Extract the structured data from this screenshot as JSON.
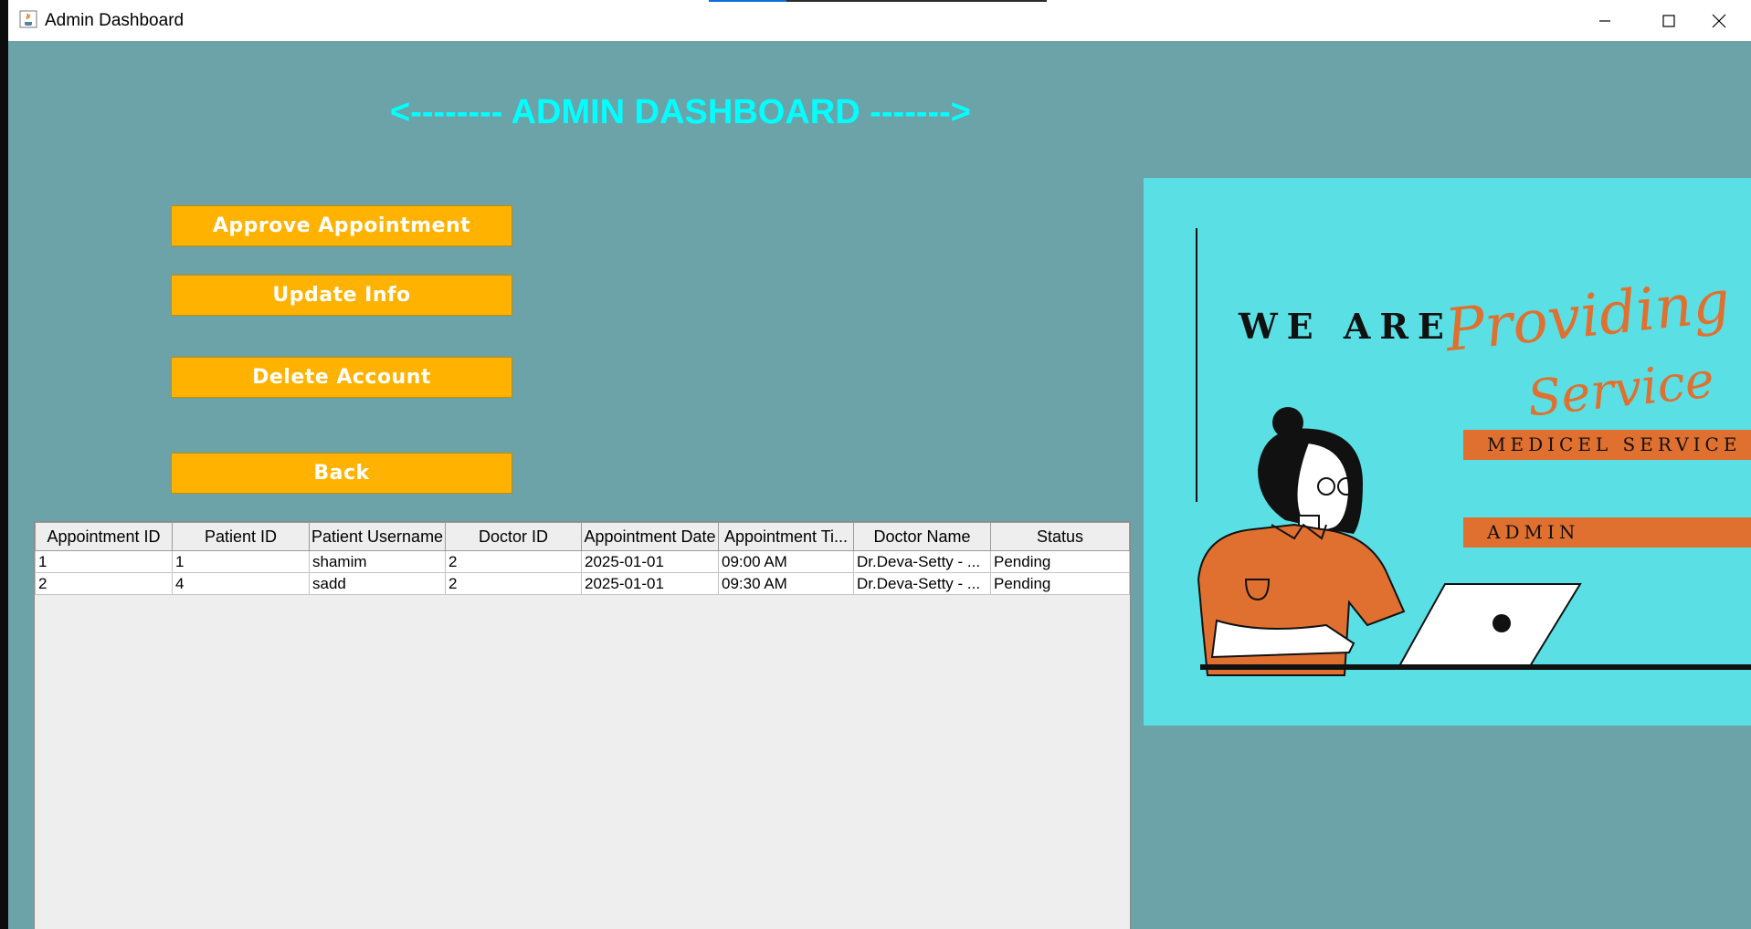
{
  "window": {
    "title": "Admin Dashboard",
    "controls": [
      "minimize-icon",
      "maximize-icon",
      "close-icon"
    ]
  },
  "heading": "<-------- ADMIN DASHBOARD ------->",
  "buttons": {
    "approve": "Approve Appointment",
    "update": "Update Info",
    "delete": "Delete Account",
    "back": "Back"
  },
  "table": {
    "columns": [
      "Appointment ID",
      "Patient ID",
      "Patient Username",
      "Doctor ID",
      "Appointment Date",
      "Appointment Ti...",
      "Doctor Name",
      "Status"
    ],
    "rows": [
      [
        "1",
        "1",
        "shamim",
        "2",
        "2025-01-01",
        "09:00 AM",
        "Dr.Deva-Setty - ...",
        "Pending"
      ],
      [
        "2",
        "4",
        "sadd",
        "2",
        "2025-01-01",
        "09:30 AM",
        "Dr.Deva-Setty - ...",
        "Pending"
      ]
    ]
  },
  "poster": {
    "line1": "WE ARE",
    "line2": "Providing",
    "line3": "Service",
    "band1": "MEDICEL SERVICE",
    "band2": "ADMIN"
  },
  "colors": {
    "background": "#6ba3a8",
    "heading": "#00ffff",
    "button": "#ffb300",
    "poster_bg": "#5ae0e4",
    "accent_orange": "#e07030"
  }
}
